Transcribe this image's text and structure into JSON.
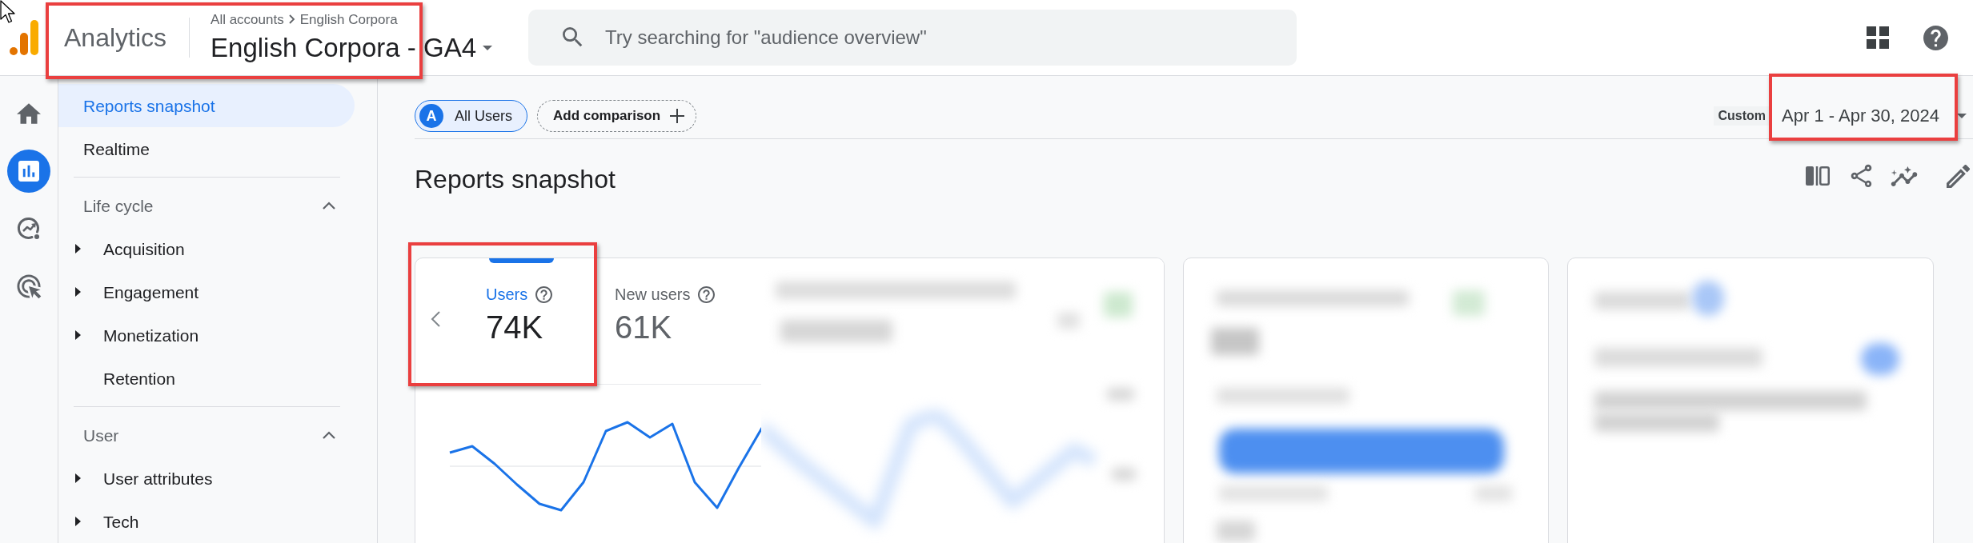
{
  "header": {
    "product": "Analytics",
    "breadcrumb": [
      "All accounts",
      "English Corpora"
    ],
    "property": "English Corpora - GA4",
    "highlighted": true,
    "search": {
      "placeholder": "Try searching for \"audience overview\""
    }
  },
  "nav_rail": [
    {
      "kind": "home",
      "selected": false
    },
    {
      "kind": "reports",
      "selected": true
    },
    {
      "kind": "explore",
      "selected": false
    },
    {
      "kind": "advertising",
      "selected": false
    }
  ],
  "sidebar": {
    "items": [
      {
        "label": "Reports snapshot",
        "selected": true
      },
      {
        "label": "Realtime",
        "selected": false
      }
    ],
    "sections": [
      {
        "title": "Life cycle",
        "expanded": true,
        "items": [
          {
            "label": "Acquisition",
            "kind": "group",
            "selected": false
          },
          {
            "label": "Engagement",
            "kind": "group",
            "selected": false
          },
          {
            "label": "Monetization",
            "kind": "group",
            "selected": false
          },
          {
            "label": "Retention",
            "kind": "link",
            "selected": false
          }
        ]
      },
      {
        "title": "User",
        "expanded": true,
        "items": [
          {
            "label": "User attributes",
            "kind": "group",
            "selected": false
          },
          {
            "label": "Tech",
            "kind": "group",
            "selected": false
          }
        ]
      }
    ]
  },
  "comparison_bar": {
    "segments": [
      {
        "badge": "A",
        "label": "All Users"
      }
    ],
    "add_comparison": "Add comparison",
    "date_range": {
      "preset": "Custom",
      "range": "Apr 1 - Apr 30, 2024",
      "highlighted": true
    }
  },
  "page_title": "Reports snapshot",
  "overview_card": {
    "metrics": [
      {
        "label": "Users",
        "value": "74K",
        "selected": true,
        "highlighted": true
      },
      {
        "label": "New users",
        "value": "61K",
        "selected": false,
        "highlighted": false
      }
    ]
  }
}
